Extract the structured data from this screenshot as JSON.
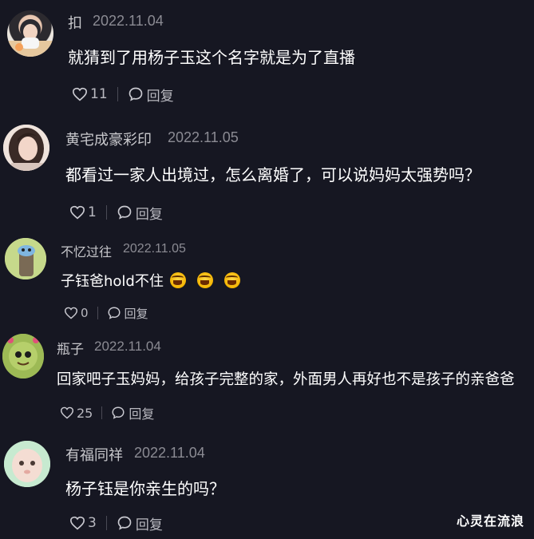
{
  "comments": [
    {
      "username": "扣",
      "date": "2022.11.04",
      "text": "就猜到了用杨子玉这个名字就是为了直播",
      "likes": "11",
      "reply": "回复"
    },
    {
      "username": "黄宅成豪彩印",
      "date": "2022.11.05",
      "text": "都看过一家人出境过，怎么离婚了，可以说妈妈太强势吗？",
      "likes": "1",
      "reply": "回复"
    },
    {
      "username": "不忆过往",
      "date": "2022.11.05",
      "text": "子钰爸hold不住",
      "likes": "0",
      "reply": "回复"
    },
    {
      "username": "瓶子",
      "date": "2022.11.04",
      "text": "回家吧子玉妈妈，给孩子完整的家，外面男人再好也不是孩子的亲爸爸",
      "likes": "25",
      "reply": "回复"
    },
    {
      "username": "有福同祥",
      "date": "2022.11.04",
      "text": "杨子钰是你亲生的吗？",
      "likes": "3",
      "reply": "回复"
    }
  ],
  "emoji_icons": [
    "laughing-crying-emoji",
    "laughing-crying-emoji",
    "laughing-crying-emoji"
  ],
  "watermark": "心灵在流浪",
  "colors": {
    "background": "#161722",
    "username": "#c8c8cc",
    "date": "#8b8b93",
    "text": "#ffffff",
    "action": "#b9b9c0"
  }
}
